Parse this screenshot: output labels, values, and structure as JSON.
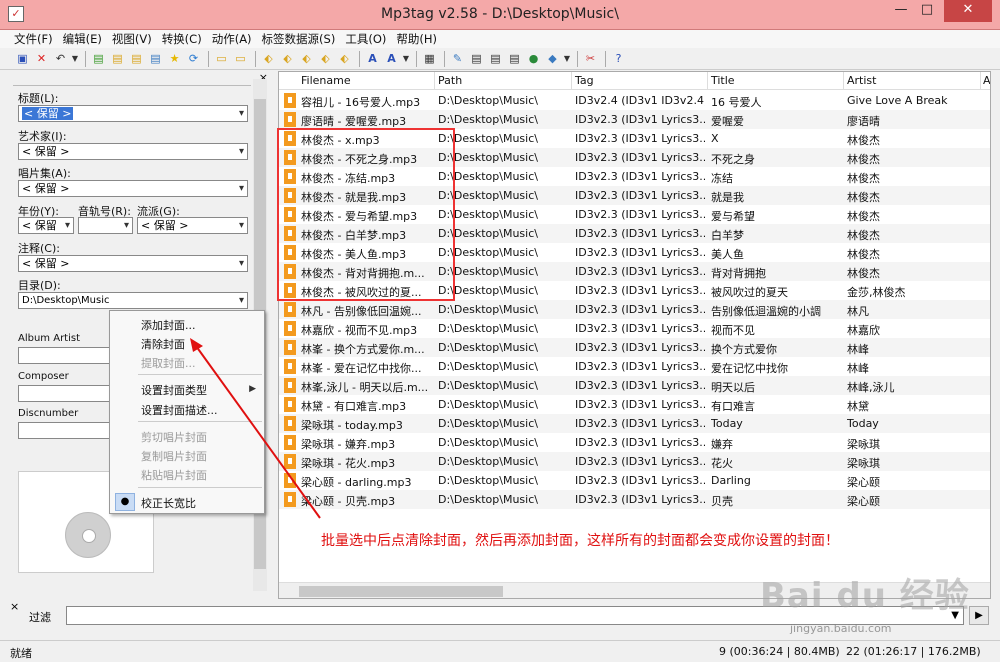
{
  "window": {
    "title": "Mp3tag v2.58  -  D:\\Desktop\\Music\\",
    "minimize": "—",
    "maximize": "□",
    "close": "✕"
  },
  "menu": [
    "文件(F)",
    "编辑(E)",
    "视图(V)",
    "转换(C)",
    "动作(A)",
    "标签数据源(S)",
    "工具(O)",
    "帮助(H)"
  ],
  "toolbar_icons": [
    "save-icon",
    "delete-icon",
    "undo-icon",
    "dropdown-icon",
    "add-folder-icon",
    "open-folder-icon",
    "add-file-icon",
    "refresh-icon",
    "favorite-icon",
    "reload-icon",
    "folder-open-icon",
    "folder-icon",
    "tag-to-filename-icon",
    "filename-to-tag-icon",
    "tag-to-tag-icon",
    "text-file-icon",
    "autonumber-icon",
    "case-convert-icon",
    "edit-icon",
    "export-icon",
    "playlist-icon",
    "web-source-icon",
    "globe-icon",
    "action-icon",
    "tools-icon",
    "help-icon"
  ],
  "tag_panel": {
    "title_label": "标题(L):",
    "title_value": "< 保留 >",
    "artist_label": "艺术家(I):",
    "artist_value": "< 保留 >",
    "album_label": "唱片集(A):",
    "album_value": "< 保留 >",
    "year_label": "年份(Y):",
    "year_value": "< 保留",
    "track_label": "音轨号(R):",
    "track_value": "",
    "genre_label": "流派(G):",
    "genre_value": "< 保留 >",
    "comment_label": "注释(C):",
    "comment_value": "< 保留 >",
    "directory_label": "目录(D):",
    "directory_value": "D:\\Desktop\\Music",
    "album_artist_label": "Album Artist",
    "composer_label": "Composer",
    "discnumber_label": "Discnumber"
  },
  "context_menu": {
    "add_cover": "添加封面...",
    "remove_cover": "清除封面",
    "extract_cover": "提取封面...",
    "set_cover_type": "设置封面类型",
    "set_cover_desc": "设置封面描述...",
    "cut_cover": "剪切唱片封面",
    "copy_cover": "复制唱片封面",
    "paste_cover": "粘贴唱片封面",
    "fix_aspect": "校正长宽比"
  },
  "columns": [
    "Filename",
    "Path",
    "Tag",
    "Title",
    "Artist",
    "A"
  ],
  "rows": [
    [
      "容祖儿 - 16号爱人.mp3",
      "D:\\Desktop\\Music\\",
      "ID3v2.4 (ID3v1 ID3v2.4)",
      "16 号爱人",
      "Give Love A Break"
    ],
    [
      "廖语晴 - 爱喔爱.mp3",
      "D:\\Desktop\\Music\\",
      "ID3v2.3 (ID3v1 Lyrics3...",
      "爱喔爱",
      "廖语晴"
    ],
    [
      "林俊杰 - x.mp3",
      "D:\\Desktop\\Music\\",
      "ID3v2.3 (ID3v1 Lyrics3...",
      "X",
      "林俊杰"
    ],
    [
      "林俊杰 - 不死之身.mp3",
      "D:\\Desktop\\Music\\",
      "ID3v2.3 (ID3v1 Lyrics3...",
      "不死之身",
      "林俊杰"
    ],
    [
      "林俊杰 - 冻结.mp3",
      "D:\\Desktop\\Music\\",
      "ID3v2.3 (ID3v1 Lyrics3...",
      "冻结",
      "林俊杰"
    ],
    [
      "林俊杰 - 就是我.mp3",
      "D:\\Desktop\\Music\\",
      "ID3v2.3 (ID3v1 Lyrics3...",
      "就是我",
      "林俊杰"
    ],
    [
      "林俊杰 - 爱与希望.mp3",
      "D:\\Desktop\\Music\\",
      "ID3v2.3 (ID3v1 Lyrics3...",
      "爱与希望",
      "林俊杰"
    ],
    [
      "林俊杰 - 白羊梦.mp3",
      "D:\\Desktop\\Music\\",
      "ID3v2.3 (ID3v1 Lyrics3...",
      "白羊梦",
      "林俊杰"
    ],
    [
      "林俊杰 - 美人鱼.mp3",
      "D:\\Desktop\\Music\\",
      "ID3v2.3 (ID3v1 Lyrics3...",
      "美人鱼",
      "林俊杰"
    ],
    [
      "林俊杰 - 背对背拥抱.m...",
      "D:\\Desktop\\Music\\",
      "ID3v2.3 (ID3v1 Lyrics3...",
      "背对背拥抱",
      "林俊杰"
    ],
    [
      "林俊杰 - 被风吹过的夏...",
      "D:\\Desktop\\Music\\",
      "ID3v2.3 (ID3v1 Lyrics3...",
      "被风吹过的夏天",
      "金莎,林俊杰"
    ],
    [
      "林凡 - 告别像低回温婉...",
      "D:\\Desktop\\Music\\",
      "ID3v2.3 (ID3v1 Lyrics3...",
      "告别像低迴溫婉的小調",
      "林凡"
    ],
    [
      "林嘉欣 - 视而不见.mp3",
      "D:\\Desktop\\Music\\",
      "ID3v2.3 (ID3v1 Lyrics3...",
      "视而不见",
      "林嘉欣"
    ],
    [
      "林峯 - 换个方式爱你.m...",
      "D:\\Desktop\\Music\\",
      "ID3v2.3 (ID3v1 Lyrics3...",
      "换个方式爱你",
      "林峰"
    ],
    [
      "林峯 - 爱在记忆中找你...",
      "D:\\Desktop\\Music\\",
      "ID3v2.3 (ID3v1 Lyrics3...",
      "爱在记忆中找你",
      "林峰"
    ],
    [
      "林峯,泳儿 - 明天以后.m...",
      "D:\\Desktop\\Music\\",
      "ID3v2.3 (ID3v1 Lyrics3...",
      "明天以后",
      "林峰,泳儿"
    ],
    [
      "林黛 - 有口难言.mp3",
      "D:\\Desktop\\Music\\",
      "ID3v2.3 (ID3v1 Lyrics3...",
      "有口难言",
      "林黛"
    ],
    [
      "梁咏琪 - today.mp3",
      "D:\\Desktop\\Music\\",
      "ID3v2.3 (ID3v1 Lyrics3...",
      "Today",
      "Today"
    ],
    [
      "梁咏琪 - 嫌弃.mp3",
      "D:\\Desktop\\Music\\",
      "ID3v2.3 (ID3v1 Lyrics3...",
      "嫌弃",
      "梁咏琪"
    ],
    [
      "梁咏琪 - 花火.mp3",
      "D:\\Desktop\\Music\\",
      "ID3v2.3 (ID3v1 Lyrics3...",
      "花火",
      "梁咏琪"
    ],
    [
      "梁心颐 - darling.mp3",
      "D:\\Desktop\\Music\\",
      "ID3v2.3 (ID3v1 Lyrics3...",
      "Darling",
      "梁心颐"
    ],
    [
      "梁心颐 - 贝壳.mp3",
      "D:\\Desktop\\Music\\",
      "ID3v2.3 (ID3v1 Lyrics3...",
      "贝壳",
      "梁心颐"
    ]
  ],
  "filter": {
    "label": "过滤",
    "value": ""
  },
  "status": {
    "ready": "就绪",
    "selected": "9 (00:36:24 | 80.4MB)",
    "total": "22 (01:26:17 | 176.2MB)"
  },
  "annotation": {
    "text": "批量选中后点清除封面，然后再添加封面，这样所有的封面都会变成你设置的封面！",
    "color": "#e01010"
  },
  "watermark": {
    "logo": "Bai du 经验",
    "url": "jingyan.baidu.com"
  }
}
